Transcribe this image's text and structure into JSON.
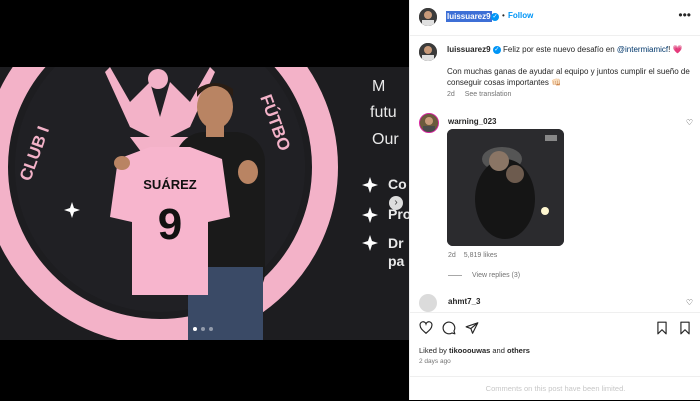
{
  "post": {
    "username": "luissuarez9",
    "follow_label": "Follow",
    "separator": "•",
    "more_label": "•••"
  },
  "caption": {
    "username": "luissuarez9",
    "text_before": "Feliz por este nuevo desafío en ",
    "mention": "@intermiamicf",
    "text_after": "! 💗",
    "body": "Con muchas ganas de ayudar al equipo y juntos cumplir el sueño de conseguir cosas importantes 👊🏻",
    "age": "2d",
    "translate_label": "See translation"
  },
  "comments": [
    {
      "username": "warning_023",
      "age": "2d",
      "likes": "5,819 likes",
      "view_replies": "View replies (3)"
    },
    {
      "username": "ahmt7_3"
    }
  ],
  "photo": {
    "jersey_name": "SUÁREZ",
    "jersey_number": "9",
    "badge_left": "CLUB I",
    "badge_right": "FÚTBO",
    "wall_text_1": "M",
    "wall_text_2": "futu",
    "wall_text_3": "Our",
    "wall_text_4": "Co",
    "wall_text_5": "Pro",
    "wall_text_6": "Dr",
    "wall_text_7": "pa",
    "carousel_next": "›"
  },
  "engagement": {
    "liked_prefix": "Liked by ",
    "liked_user": "tikooouwas",
    "liked_middle": " and ",
    "liked_others": "others",
    "time_ago": "2 days ago"
  },
  "footer": {
    "limited_text": "Comments on this post have been limited."
  },
  "colors": {
    "accent": "#0095f6",
    "badge_pink": "#f7b5cd",
    "mention": "#00376b"
  }
}
